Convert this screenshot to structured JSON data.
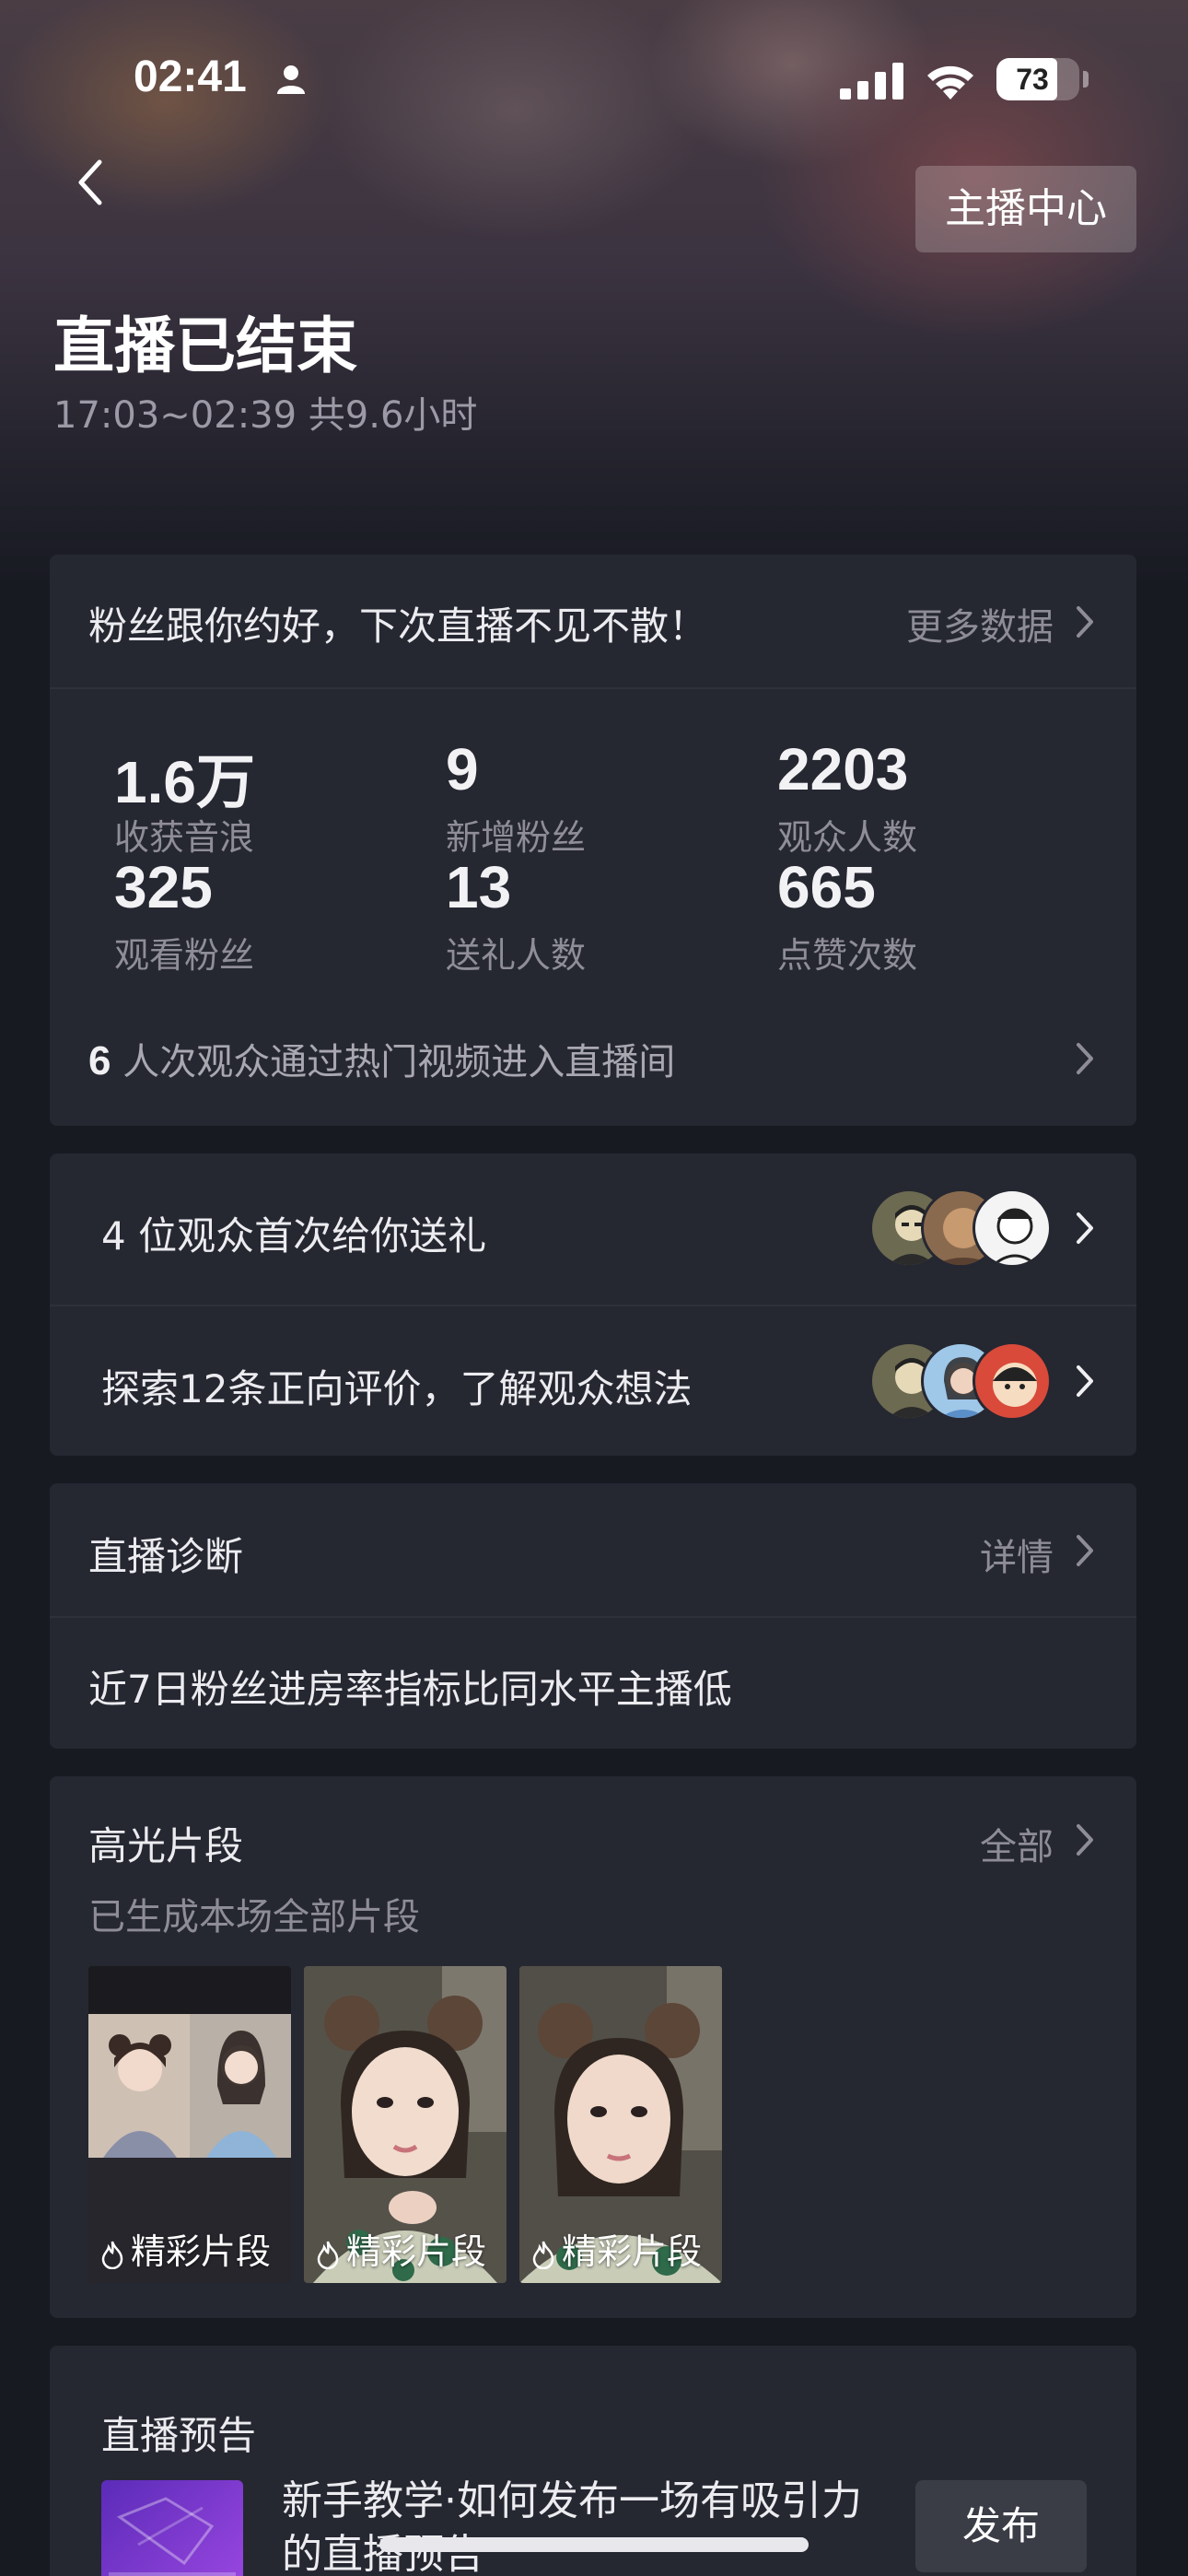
{
  "status_bar": {
    "time": "02:41",
    "battery": "73",
    "battery_level": 0.73
  },
  "header": {
    "host_center_label": "主播中心",
    "title": "直播已结束",
    "subtitle": "17:03~02:39 共9.6小时"
  },
  "summary_card": {
    "headline": "粉丝跟你约好，下次直播不见不散！",
    "more_link": "更多数据",
    "stats": [
      {
        "value": "1.6万",
        "label": "收获音浪"
      },
      {
        "value": "9",
        "label": "新增粉丝"
      },
      {
        "value": "2203",
        "label": "观众人数"
      },
      {
        "value": "325",
        "label": "观看粉丝"
      },
      {
        "value": "13",
        "label": "送礼人数"
      },
      {
        "value": "665",
        "label": "点赞次数"
      }
    ],
    "hot_video_count": "6",
    "hot_video_text": "人次观众通过热门视频进入直播间"
  },
  "audience_card": {
    "gift_row": "4 位观众首次给你送礼",
    "review_row": "探索12条正向评价，了解观众想法"
  },
  "diagnosis_card": {
    "title": "直播诊断",
    "details_link": "详情",
    "message": "近7日粉丝进房率指标比同水平主播低"
  },
  "highlights_card": {
    "title": "高光片段",
    "all_link": "全部",
    "subtitle": "已生成本场全部片段",
    "clips": [
      {
        "label": "精彩片段"
      },
      {
        "label": "精彩片段"
      },
      {
        "label": "精彩片段"
      }
    ]
  },
  "preview_card": {
    "title": "直播预告",
    "tutorial_text": "新手教学·如何发布一场有吸引力的直播预告",
    "publish_label": "发布"
  },
  "colors": {
    "background": "#181a22",
    "card": "#252731",
    "muted_text": "#8f8e98",
    "accent_purple": "#8b3fd9"
  },
  "icons": [
    "person-icon",
    "signal-icon",
    "wifi-icon",
    "back-icon",
    "chevron-right-icon",
    "flame-icon"
  ]
}
